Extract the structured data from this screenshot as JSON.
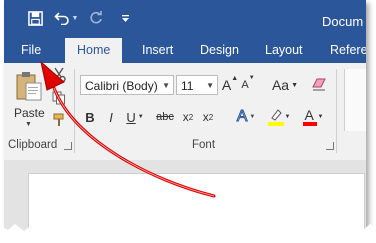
{
  "title_bar": {
    "document_title": "Docum"
  },
  "tabs": [
    "File",
    "Home",
    "Insert",
    "Design",
    "Layout",
    "Refere"
  ],
  "clipboard": {
    "paste_label": "Paste",
    "group_label": "Clipboard"
  },
  "font": {
    "font_name": "Calibri (Body)",
    "font_size": "11",
    "grow_label": "A",
    "shrink_label": "A",
    "case_label": "Aa",
    "bold": "B",
    "italic": "I",
    "underline": "U",
    "strikethrough": "abc",
    "subscript": "x",
    "subscript_suffix": "2",
    "superscript": "x",
    "superscript_suffix": "2",
    "effects_label": "A",
    "font_color_label": "A",
    "group_label": "Font"
  },
  "colors": {
    "brand": "#2b579a",
    "highlight": "#ffff00",
    "font_color": "#ff0000",
    "annotation_arrow": "#e00000"
  }
}
